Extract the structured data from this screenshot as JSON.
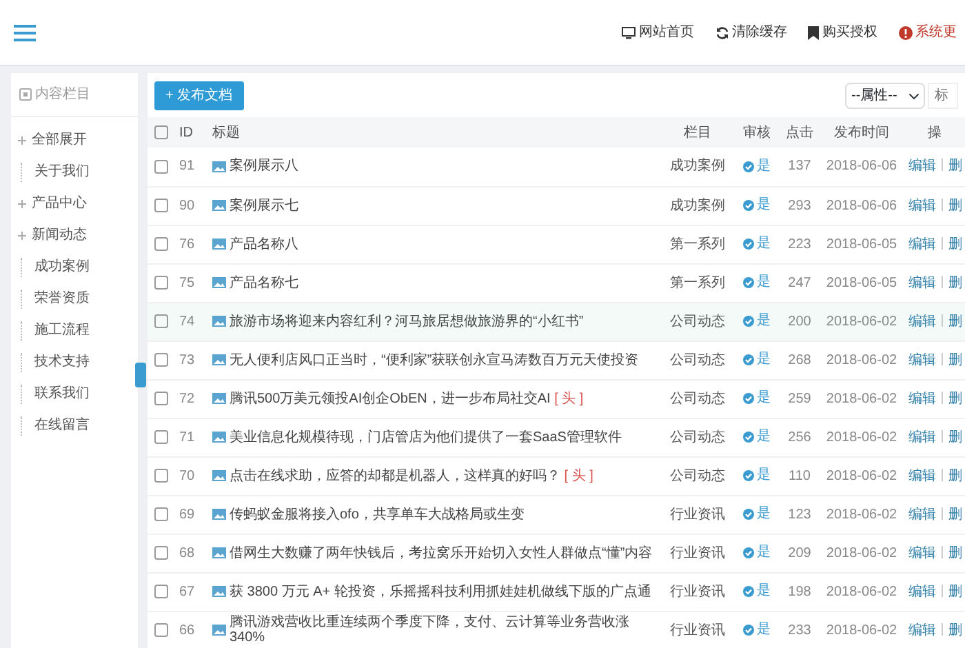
{
  "header": {
    "links": [
      {
        "label": "网站首页",
        "kind": "normal"
      },
      {
        "label": "清除缓存",
        "kind": "normal"
      },
      {
        "label": "购买授权",
        "kind": "normal"
      },
      {
        "label": "系统更",
        "kind": "warning"
      }
    ]
  },
  "sidebar": {
    "title": "内容栏目",
    "items": [
      {
        "label": "全部展开",
        "expandable": true
      },
      {
        "label": "关于我们",
        "expandable": false
      },
      {
        "label": "产品中心",
        "expandable": true
      },
      {
        "label": "新闻动态",
        "expandable": true
      },
      {
        "label": "成功案例",
        "expandable": false
      },
      {
        "label": "荣誉资质",
        "expandable": false
      },
      {
        "label": "施工流程",
        "expandable": false
      },
      {
        "label": "技术支持",
        "expandable": false
      },
      {
        "label": "联系我们",
        "expandable": false
      },
      {
        "label": "在线留言",
        "expandable": false
      }
    ]
  },
  "toolbar": {
    "add_button": "+ 发布文档",
    "filter_select": "--属性--",
    "search": {
      "placeholder": "标"
    }
  },
  "table": {
    "select_all_checked": false,
    "columns": [
      "ID",
      "标题",
      "栏目",
      "审核",
      "点击",
      "发布时间",
      "操"
    ],
    "rows": [
      {
        "checked": false,
        "id": "91",
        "title": "案例展示八",
        "tag": null,
        "category": "成功案例",
        "approved": true,
        "audit": "是",
        "clicks": "137",
        "date": "2018-06-06",
        "edit": "编辑",
        "delete": "删",
        "highlighted": false
      },
      {
        "checked": false,
        "id": "90",
        "title": "案例展示七",
        "tag": null,
        "category": "成功案例",
        "approved": true,
        "audit": "是",
        "clicks": "293",
        "date": "2018-06-06",
        "edit": "编辑",
        "delete": "删",
        "highlighted": false
      },
      {
        "checked": false,
        "id": "76",
        "title": "产品名称八",
        "tag": null,
        "category": "第一系列",
        "approved": true,
        "audit": "是",
        "clicks": "223",
        "date": "2018-06-05",
        "edit": "编辑",
        "delete": "删",
        "highlighted": false
      },
      {
        "checked": false,
        "id": "75",
        "title": "产品名称七",
        "tag": null,
        "category": "第一系列",
        "approved": true,
        "audit": "是",
        "clicks": "247",
        "date": "2018-06-05",
        "edit": "编辑",
        "delete": "删",
        "highlighted": false
      },
      {
        "checked": false,
        "id": "74",
        "title": "旅游市场将迎来内容红利？河马旅居想做旅游界的“小红书”",
        "tag": null,
        "category": "公司动态",
        "approved": true,
        "audit": "是",
        "clicks": "200",
        "date": "2018-06-02",
        "edit": "编辑",
        "delete": "删",
        "highlighted": true
      },
      {
        "checked": false,
        "id": "73",
        "title": "无人便利店风口正当时，“便利家”获联创永宣马涛数百万元天使投资",
        "tag": null,
        "category": "公司动态",
        "approved": true,
        "audit": "是",
        "clicks": "268",
        "date": "2018-06-02",
        "edit": "编辑",
        "delete": "删",
        "highlighted": false
      },
      {
        "checked": false,
        "id": "72",
        "title": "腾讯500万美元领投AI创企ObEN，进一步布局社交AI",
        "tag": "[ 头 ]",
        "category": "公司动态",
        "approved": true,
        "audit": "是",
        "clicks": "259",
        "date": "2018-06-02",
        "edit": "编辑",
        "delete": "删",
        "highlighted": false
      },
      {
        "checked": false,
        "id": "71",
        "title": "美业信息化规模待现，门店管店为他们提供了一套SaaS管理软件",
        "tag": null,
        "category": "公司动态",
        "approved": true,
        "audit": "是",
        "clicks": "256",
        "date": "2018-06-02",
        "edit": "编辑",
        "delete": "删",
        "highlighted": false
      },
      {
        "checked": false,
        "id": "70",
        "title": "点击在线求助，应答的却都是机器人，这样真的好吗？",
        "tag": "[ 头 ]",
        "category": "公司动态",
        "approved": true,
        "audit": "是",
        "clicks": "110",
        "date": "2018-06-02",
        "edit": "编辑",
        "delete": "删",
        "highlighted": false
      },
      {
        "checked": false,
        "id": "69",
        "title": "传蚂蚁金服将接入ofo，共享单车大战格局或生变",
        "tag": null,
        "category": "行业资讯",
        "approved": true,
        "audit": "是",
        "clicks": "123",
        "date": "2018-06-02",
        "edit": "编辑",
        "delete": "删",
        "highlighted": false
      },
      {
        "checked": false,
        "id": "68",
        "title": "借网生大数赚了两年快钱后，考拉窝乐开始切入女性人群做点“懂”内容",
        "tag": null,
        "category": "行业资讯",
        "approved": true,
        "audit": "是",
        "clicks": "209",
        "date": "2018-06-02",
        "edit": "编辑",
        "delete": "删",
        "highlighted": false
      },
      {
        "checked": false,
        "id": "67",
        "title": "获 3800 万元 A+ 轮投资，乐摇摇科技利用抓娃娃机做线下版的广点通",
        "tag": null,
        "category": "行业资讯",
        "approved": true,
        "audit": "是",
        "clicks": "198",
        "date": "2018-06-02",
        "edit": "编辑",
        "delete": "删",
        "highlighted": false
      },
      {
        "checked": false,
        "id": "66",
        "title": "腾讯游戏营收比重连续两个季度下降，支付、云计算等业务营收涨340%",
        "tag": null,
        "category": "行业资讯",
        "approved": true,
        "audit": "是",
        "clicks": "233",
        "date": "2018-06-02",
        "edit": "编辑",
        "delete": "删",
        "highlighted": false
      }
    ]
  }
}
